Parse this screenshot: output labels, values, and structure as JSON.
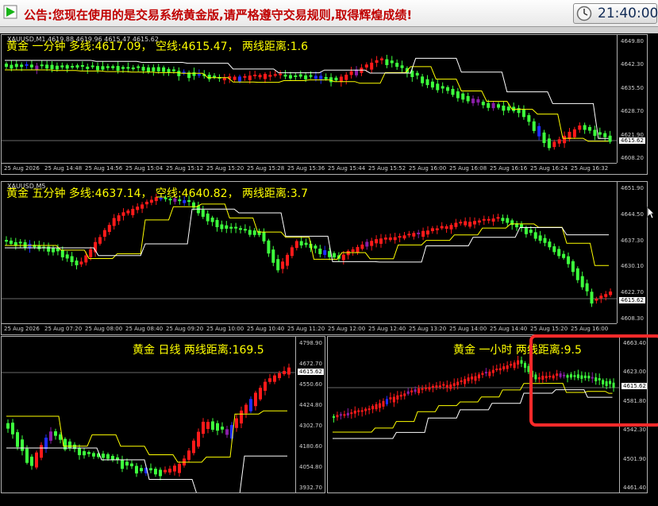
{
  "title_bar": {
    "notice": "公告:您现在使用的是交易系统黄金版,请严格遵守交易规则,取得辉煌成绩!",
    "clock": "21:40:00",
    "app_icon": "green-play-arrow-icon",
    "clock_icon": "clock-icon"
  },
  "colors": {
    "bull": "#ff1a1a",
    "bear": "#3dff3d",
    "blue": "#1e2dff",
    "purple": "#8a1ea8",
    "ma_fast": "#ffff00",
    "ma_slow": "#ffffff",
    "header_text": "#ffff00"
  },
  "panels": [
    {
      "id": "m1",
      "symbol_info": "XAUUSD,M1  4619.88 4619.96 4615.47 4615.62",
      "header": "黄金 一分钟  多线:4617.09，  空线:4615.47，  两线距离:1.6",
      "price_ticks": [
        "4649.80",
        "4642.30",
        "4635.50",
        "4628.70",
        "4621.90",
        "4608.20"
      ],
      "current_price": "4615.62",
      "time_ticks": [
        "25 Aug 2026",
        "25 Aug 14:48",
        "25 Aug 14:56",
        "25 Aug 15:04",
        "25 Aug 15:12",
        "25 Aug 15:20",
        "25 Aug 15:28",
        "25 Aug 15:36",
        "25 Aug 15:44",
        "25 Aug 15:52",
        "25 Aug 16:00",
        "25 Aug 16:08",
        "25 Aug 16:16",
        "25 Aug 16:24",
        "25 Aug 16:32"
      ]
    },
    {
      "id": "m5",
      "symbol_info": "XAUUSD,M5",
      "header": "黄金 五分钟  多线:4637.14，  空线:4640.82，  两线距离:3.7",
      "price_ticks": [
        "4651.90",
        "4644.50",
        "4637.30",
        "4630.10",
        "4622.70",
        "4608.30"
      ],
      "current_price": "4615.62",
      "time_ticks": [
        "25 Aug 2026",
        "25 Aug 07:20",
        "25 Aug 08:00",
        "25 Aug 08:40",
        "25 Aug 09:20",
        "25 Aug 10:00",
        "25 Aug 10:40",
        "25 Aug 11:20",
        "25 Aug 12:00",
        "25 Aug 12:40",
        "25 Aug 13:20",
        "25 Aug 14:00",
        "25 Aug 14:40",
        "25 Aug 15:20",
        "25 Aug 16:00"
      ]
    },
    {
      "id": "d1",
      "header": "黄金 日线  两线距离:169.5",
      "price_ticks": [
        "4798.90",
        "4672.70",
        "4550.60",
        "4424.80",
        "4302.70",
        "4180.60",
        "4054.80",
        "3932.70"
      ],
      "current_price": "4615.62"
    },
    {
      "id": "h1",
      "header": "黄金 一小时  两线距离:9.5",
      "price_ticks": [
        "4663.40",
        "4623.00",
        "4581.80",
        "4542.30",
        "4501.90",
        "4461.40"
      ],
      "current_price": "4615.62"
    }
  ]
}
